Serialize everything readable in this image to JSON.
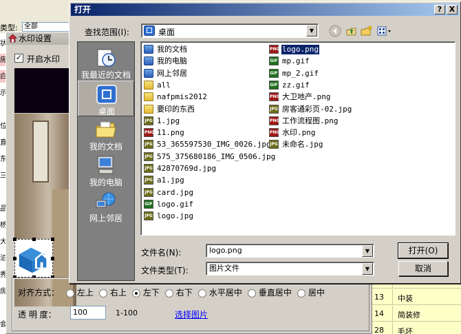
{
  "background": {
    "filter_label": "类型:",
    "filter_value": "全部",
    "left_cells": [
      "状",
      "房",
      "白",
      "示",
      "",
      "位",
      "直",
      "东",
      "三",
      "",
      "品",
      "杨",
      "大",
      "泊",
      "秀",
      "房",
      "",
      "会"
    ],
    "right_rows": [
      {
        "num": "",
        "text": ""
      },
      {
        "num": "",
        "text": ""
      },
      {
        "num": "",
        "text": ""
      },
      {
        "num": "",
        "text": ""
      },
      {
        "num": "",
        "text": ""
      },
      {
        "num": "",
        "text": ""
      },
      {
        "num": "",
        "text": ""
      },
      {
        "num": "",
        "text": ""
      },
      {
        "num": "",
        "text": ""
      },
      {
        "num": "",
        "text": ""
      },
      {
        "num": "",
        "text": ""
      },
      {
        "num": "",
        "text": ""
      },
      {
        "num": "",
        "text": ""
      },
      {
        "num": "",
        "text": ""
      },
      {
        "num": "",
        "text": ""
      },
      {
        "num": "13",
        "text": "中装"
      },
      {
        "num": "14",
        "text": "简装修"
      },
      {
        "num": "28",
        "text": "毛坯"
      }
    ]
  },
  "watermark": {
    "title": "水印设置",
    "enable_label": "开启水印",
    "enable_checked": true,
    "align_label": "对齐方式：",
    "align_options": [
      "左上",
      "右上",
      "左下",
      "右下",
      "水平居中",
      "垂直居中",
      "居中"
    ],
    "align_selected": 2,
    "transparency_label": "透 明 度：",
    "transparency_value": "100",
    "transparency_range": "1-100",
    "choose_image_link": "选择图片"
  },
  "dialog": {
    "title": "打开",
    "help_btn": "?",
    "close_btn": "X",
    "look_in_label": "查找范围(I):",
    "look_in_value": "桌面",
    "places": [
      {
        "label": "我最近的文档",
        "icon": "recent-docs-icon"
      },
      {
        "label": "桌面",
        "icon": "desktop-icon"
      },
      {
        "label": "我的文档",
        "icon": "my-documents-icon"
      },
      {
        "label": "我的电脑",
        "icon": "my-computer-icon"
      },
      {
        "label": "网上邻居",
        "icon": "network-icon"
      }
    ],
    "files_col1": [
      {
        "name": "我的文档",
        "type": "sys"
      },
      {
        "name": "我的电脑",
        "type": "sys"
      },
      {
        "name": "网上邻居",
        "type": "sys"
      },
      {
        "name": "all",
        "type": "folder"
      },
      {
        "name": "nafpmis2012",
        "type": "folder"
      },
      {
        "name": "要印的东西",
        "type": "folder"
      },
      {
        "name": "1.jpg",
        "type": "jpg"
      },
      {
        "name": "11.png",
        "type": "png"
      },
      {
        "name": "53_365597530_IMG_0026.jpg",
        "type": "jpg"
      },
      {
        "name": "575_375680186_IMG_0506.jpg",
        "type": "jpg"
      },
      {
        "name": "42870769d.jpg",
        "type": "jpg"
      },
      {
        "name": "a1.jpg",
        "type": "jpg"
      },
      {
        "name": "card.jpg",
        "type": "jpg"
      },
      {
        "name": "logo.gif",
        "type": "gif"
      },
      {
        "name": "logo.jpg",
        "type": "jpg"
      }
    ],
    "files_col2": [
      {
        "name": "logo.png",
        "type": "png",
        "selected": true
      },
      {
        "name": "mp.gif",
        "type": "gif"
      },
      {
        "name": "mp_2.gif",
        "type": "gif"
      },
      {
        "name": "zz.gif",
        "type": "gif"
      },
      {
        "name": "大卫地产.png",
        "type": "png"
      },
      {
        "name": "房客通彩页-02.jpg",
        "type": "jpg"
      },
      {
        "name": "工作流程图.png",
        "type": "png"
      },
      {
        "name": "水印.png",
        "type": "png"
      },
      {
        "name": "未命名.jpg",
        "type": "jpg"
      }
    ],
    "file_name_label": "文件名(N):",
    "file_name_value": "logo.png",
    "file_type_label": "文件类型(T):",
    "file_type_value": "图片文件",
    "open_btn": "打开(O)",
    "cancel_btn": "取消"
  }
}
